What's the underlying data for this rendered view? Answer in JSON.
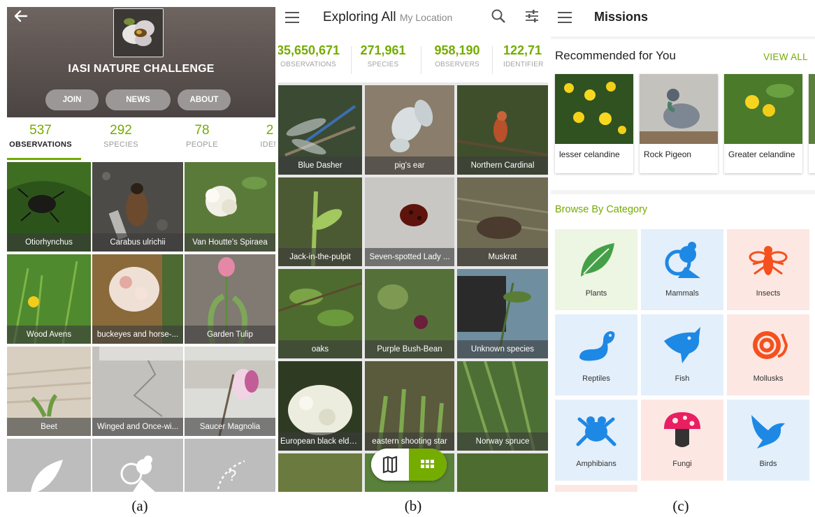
{
  "panel_a": {
    "title": "IASI NATURE CHALLENGE",
    "buttons": [
      "JOIN",
      "NEWS",
      "ABOUT"
    ],
    "stats": [
      {
        "value": "537",
        "label": "OBSERVATIONS"
      },
      {
        "value": "292",
        "label": "SPECIES"
      },
      {
        "value": "78",
        "label": "PEOPLE"
      },
      {
        "value": "2",
        "label": "IDEN"
      }
    ],
    "tiles": [
      {
        "label": "Otiorhynchus"
      },
      {
        "label": "Carabus ulrichii"
      },
      {
        "label": "Van Houtte's Spiraea"
      },
      {
        "label": "Wood Avens"
      },
      {
        "label": "buckeyes and horse-..."
      },
      {
        "label": "Garden Tulip"
      },
      {
        "label": "Beet"
      },
      {
        "label": "Winged and Once-wi..."
      },
      {
        "label": "Saucer Magnolia"
      }
    ]
  },
  "panel_b": {
    "title": "Exploring All",
    "location": "My Location",
    "stats": [
      {
        "value": "35,650,671",
        "label": "OBSERVATIONS"
      },
      {
        "value": "271,961",
        "label": "SPECIES"
      },
      {
        "value": "958,190",
        "label": "OBSERVERS"
      },
      {
        "value": "122,71",
        "label": "IDENTIFIER"
      }
    ],
    "tiles": [
      {
        "label": "Blue Dasher"
      },
      {
        "label": "pig's ear"
      },
      {
        "label": "Northern Cardinal"
      },
      {
        "label": "Jack-in-the-pulpit"
      },
      {
        "label": "Seven-spotted Lady ..."
      },
      {
        "label": "Muskrat"
      },
      {
        "label": "oaks"
      },
      {
        "label": "Purple Bush-Bean"
      },
      {
        "label": "Unknown species"
      },
      {
        "label": "European black elde..."
      },
      {
        "label": "eastern shooting star"
      },
      {
        "label": "Norway spruce"
      }
    ]
  },
  "panel_c": {
    "title": "Missions",
    "recommended_title": "Recommended for You",
    "view_all": "VIEW ALL",
    "recommended": [
      "lesser celandine",
      "Rock Pigeon",
      "Greater celandine"
    ],
    "browse_title": "Browse By Category",
    "categories": [
      {
        "label": "Plants",
        "icon": "leaf-icon"
      },
      {
        "label": "Mammals",
        "icon": "mammal-icon"
      },
      {
        "label": "Insects",
        "icon": "insect-icon"
      },
      {
        "label": "Reptiles",
        "icon": "reptile-icon"
      },
      {
        "label": "Fish",
        "icon": "fish-icon"
      },
      {
        "label": "Mollusks",
        "icon": "mollusk-icon"
      },
      {
        "label": "Amphibians",
        "icon": "frog-icon"
      },
      {
        "label": "Fungi",
        "icon": "mushroom-icon"
      },
      {
        "label": "Birds",
        "icon": "bird-icon"
      }
    ]
  },
  "captions": [
    "(a)",
    "(b)",
    "(c)"
  ],
  "colors": {
    "accent_green": "#74ac00",
    "icon_blue": "#1e88e5",
    "icon_orange": "#f4511e",
    "icon_green": "#43a047",
    "icon_pink": "#e91e63"
  }
}
